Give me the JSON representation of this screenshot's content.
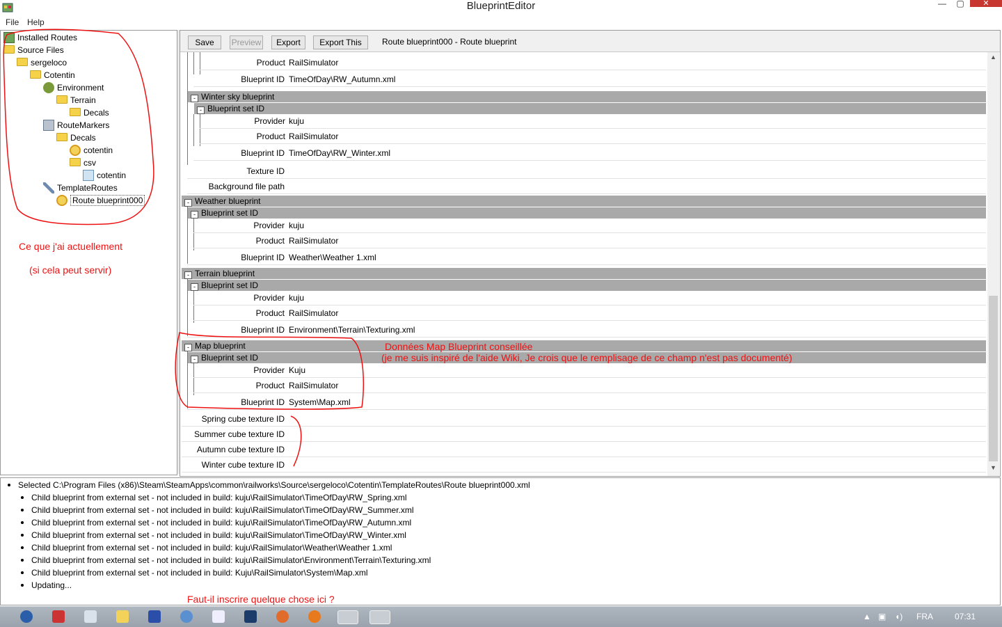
{
  "window": {
    "title": "BlueprintEditor",
    "minimize": "—",
    "maximize": "▢",
    "close": "✕"
  },
  "menu": [
    "File",
    "Help"
  ],
  "tree": [
    {
      "label": "Installed Routes",
      "icon": "routes-icon",
      "depth": 0
    },
    {
      "label": "Source Files",
      "icon": "folder-icon",
      "depth": 0
    },
    {
      "label": "sergeloco",
      "icon": "folder-icon",
      "depth": 1
    },
    {
      "label": "Cotentin",
      "icon": "folder-icon",
      "depth": 2
    },
    {
      "label": "Environment",
      "icon": "environment-icon",
      "depth": 3
    },
    {
      "label": "Terrain",
      "icon": "folder-icon",
      "depth": 4
    },
    {
      "label": "Decals",
      "icon": "folder-icon",
      "depth": 5
    },
    {
      "label": "RouteMarkers",
      "icon": "route-markers-icon",
      "depth": 3
    },
    {
      "label": "Decals",
      "icon": "folder-icon",
      "depth": 4
    },
    {
      "label": "cotentin",
      "icon": "blueprint-icon",
      "depth": 5
    },
    {
      "label": "csv",
      "icon": "folder-icon",
      "depth": 5
    },
    {
      "label": "cotentin",
      "icon": "csv-file-icon",
      "depth": 6
    },
    {
      "label": "TemplateRoutes",
      "icon": "wrench-icon",
      "depth": 3
    },
    {
      "label": "Route blueprint000",
      "icon": "blueprint-icon",
      "depth": 4,
      "selected": true
    }
  ],
  "toolbar": {
    "save": "Save",
    "preview": "Preview",
    "export": "Export",
    "export_this": "Export This",
    "current": "Route blueprint000 - Route blueprint"
  },
  "labels": {
    "provider": "Provider",
    "product": "Product",
    "blueprint_id": "Blueprint ID",
    "blueprint_set_id": "Blueprint set ID",
    "texture_id": "Texture ID",
    "background_file_path": "Background file path",
    "spring_cube": "Spring cube texture ID",
    "summer_cube": "Summer cube texture ID",
    "autumn_cube": "Autumn cube texture ID",
    "winter_cube": "Winter cube texture ID"
  },
  "grid": {
    "autumn_product": "RailSimulator",
    "autumn_blueprint_id": "TimeOfDay\\RW_Autumn.xml",
    "winter": {
      "title": "Winter sky blueprint",
      "provider": "kuju",
      "product": "RailSimulator",
      "blueprint_id": "TimeOfDay\\RW_Winter.xml"
    },
    "weather": {
      "title": "Weather blueprint",
      "provider": "kuju",
      "product": "RailSimulator",
      "blueprint_id": "Weather\\Weather 1.xml"
    },
    "terrain": {
      "title": "Terrain blueprint",
      "provider": "kuju",
      "product": "RailSimulator",
      "blueprint_id": "Environment\\Terrain\\Texturing.xml"
    },
    "map": {
      "title": "Map blueprint",
      "provider": "Kuju",
      "product": "RailSimulator",
      "blueprint_id": "System\\Map.xml"
    }
  },
  "log": [
    "Selected C:\\Program Files (x86)\\Steam\\SteamApps\\common\\railworks\\Source\\sergeloco\\Cotentin\\TemplateRoutes\\Route blueprint000.xml",
    "Child blueprint from external set - not included in build: kuju\\RailSimulator\\TimeOfDay\\RW_Spring.xml",
    "Child blueprint from external set - not included in build: kuju\\RailSimulator\\TimeOfDay\\RW_Summer.xml",
    "Child blueprint from external set - not included in build: kuju\\RailSimulator\\TimeOfDay\\RW_Autumn.xml",
    "Child blueprint from external set - not included in build: kuju\\RailSimulator\\TimeOfDay\\RW_Winter.xml",
    "Child blueprint from external set - not included in build: kuju\\RailSimulator\\Weather\\Weather 1.xml",
    "Child blueprint from external set - not included in build: kuju\\RailSimulator\\Environment\\Terrain\\Texturing.xml",
    "Child blueprint from external set - not included in build: Kuju\\RailSimulator\\System\\Map.xml",
    "Updating..."
  ],
  "annotations": {
    "current_1": "Ce que j'ai actuellement",
    "current_2": "(si cela peut servir)",
    "map_1": "Données Map Blueprint conseillée",
    "map_2": "(je me suis inspiré de l'aide Wiki, Je crois que le remplisage de ce champ n'est pas documenté)",
    "question": "Faut-il inscrire quelque chose ici ?"
  },
  "taskbar": {
    "language": "FRA",
    "time": "07:31"
  },
  "colors": {
    "annotation": "#ee1111",
    "section_header": "#a9a9a9"
  }
}
